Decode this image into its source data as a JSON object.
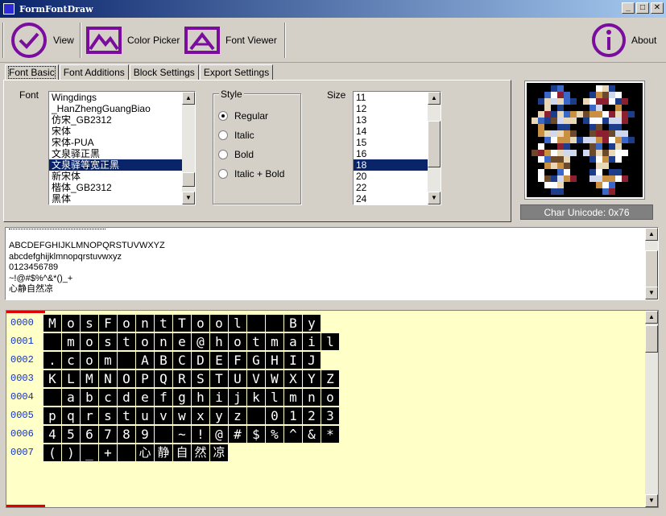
{
  "window": {
    "title": "FormFontDraw",
    "buttons": [
      "_",
      "□",
      "✕"
    ]
  },
  "toolbar": {
    "view_label": "View",
    "color_picker_label": "Color Picker",
    "font_viewer_label": "Font Viewer",
    "about_label": "About",
    "accent_color": "#7a0c9e"
  },
  "tabs": [
    {
      "label": "Font Basic",
      "active": true
    },
    {
      "label": "Font Additions",
      "active": false
    },
    {
      "label": "Block Settings",
      "active": false
    },
    {
      "label": "Export Settings",
      "active": false
    }
  ],
  "font_basic": {
    "font_label": "Font",
    "fonts": [
      "Wingdings",
      "_HanZhengGuangBiao",
      "仿宋_GB2312",
      "宋体",
      "宋体-PUA",
      "文泉驿正黑",
      "文泉驿等宽正黑",
      "新宋体",
      "楷体_GB2312",
      "黑体"
    ],
    "selected_font": "文泉驿等宽正黑",
    "style_label": "Style",
    "styles": [
      "Regular",
      "Italic",
      "Bold",
      "Italic + Bold"
    ],
    "selected_style": "Regular",
    "size_label": "Size",
    "sizes": [
      "11",
      "12",
      "13",
      "14",
      "15",
      "16",
      "18",
      "20",
      "22",
      "24"
    ],
    "selected_size": "18"
  },
  "char_unicode": "Char Unicode: 0x76",
  "text_lines": [
    "ABCDEFGHIJKLMNOPQRSTUVWXYZ",
    "abcdefghijklmnopqrstuvwxyz",
    "0123456789",
    "~!@#$%^&*()_+",
    "心静自然凉"
  ],
  "grid_rows": [
    {
      "no": "0000",
      "chars": [
        "M",
        "o",
        "s",
        "F",
        "o",
        "n",
        "t",
        "T",
        "o",
        "o",
        "l",
        " ",
        " ",
        "B",
        "y"
      ]
    },
    {
      "no": "0001",
      "chars": [
        " ",
        "m",
        "o",
        "s",
        "t",
        "o",
        "n",
        "e",
        "@",
        "h",
        "o",
        "t",
        "m",
        "a",
        "i",
        "l"
      ]
    },
    {
      "no": "0002",
      "chars": [
        ".",
        "c",
        "o",
        "m",
        " ",
        "A",
        "B",
        "C",
        "D",
        "E",
        "F",
        "G",
        "H",
        "I",
        "J"
      ]
    },
    {
      "no": "0003",
      "chars": [
        "K",
        "L",
        "M",
        "N",
        "O",
        "P",
        "Q",
        "R",
        "S",
        "T",
        "U",
        "V",
        "W",
        "X",
        "Y",
        "Z"
      ]
    },
    {
      "no": "0004",
      "chars": [
        " ",
        "a",
        "b",
        "c",
        "d",
        "e",
        "f",
        "g",
        "h",
        "i",
        "j",
        "k",
        "l",
        "m",
        "n",
        "o"
      ]
    },
    {
      "no": "0005",
      "chars": [
        "p",
        "q",
        "r",
        "s",
        "t",
        "u",
        "v",
        "w",
        "x",
        "y",
        "z",
        " ",
        "0",
        "1",
        "2",
        "3"
      ]
    },
    {
      "no": "0006",
      "chars": [
        "4",
        "5",
        "6",
        "7",
        "8",
        "9",
        " ",
        "~",
        "!",
        "@",
        "#",
        "$",
        "%",
        "^",
        "&",
        "*"
      ]
    },
    {
      "no": "0007",
      "chars": [
        "(",
        ")",
        "_",
        "+",
        " ",
        "心",
        "静",
        "自",
        "然",
        "凉"
      ]
    }
  ]
}
